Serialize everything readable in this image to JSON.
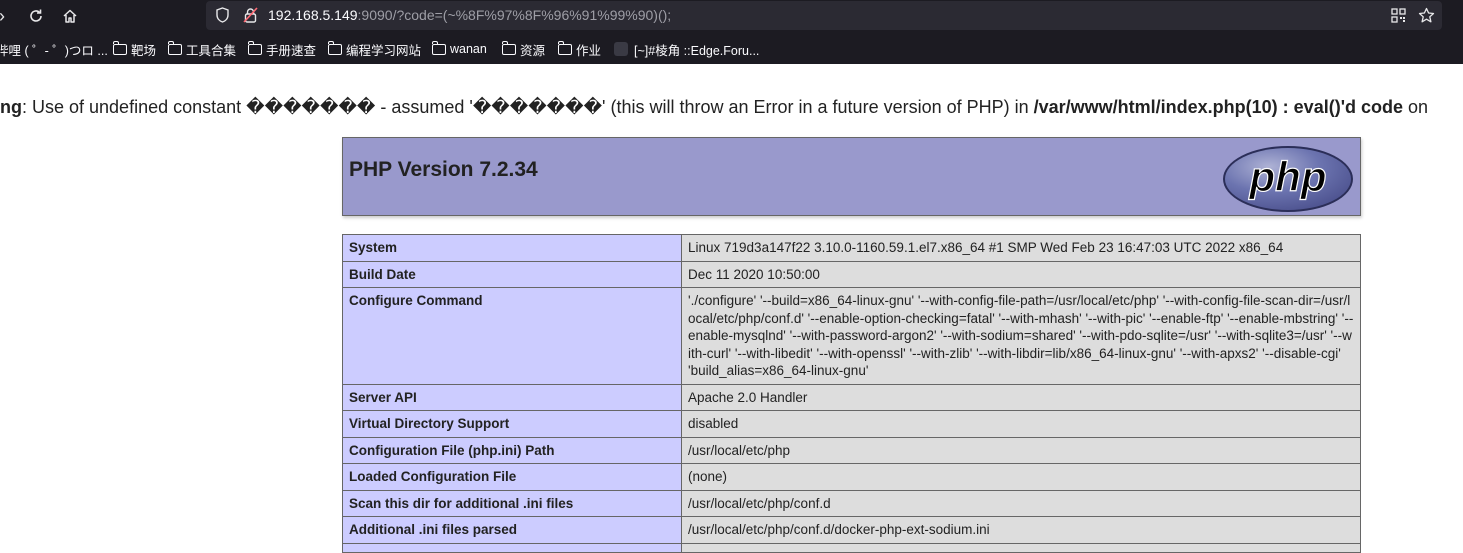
{
  "browser": {
    "url_host": "192.168.5.149",
    "url_rest": ":9090/?code=(~%8F%97%8F%96%91%99%90)();",
    "bookmarks": [
      {
        "label": "哔哩 ( ゜- ゜)つロ ...",
        "type": "link"
      },
      {
        "label": "靶场",
        "type": "folder"
      },
      {
        "label": "工具合集",
        "type": "folder"
      },
      {
        "label": "手册速查",
        "type": "folder"
      },
      {
        "label": "编程学习网站",
        "type": "folder"
      },
      {
        "label": "wanan",
        "type": "folder"
      },
      {
        "label": "资源",
        "type": "folder"
      },
      {
        "label": "作业",
        "type": "folder"
      },
      {
        "label": "[~]#棱角 ::Edge.Foru...",
        "type": "link"
      }
    ]
  },
  "warning": {
    "label": "ng",
    "message_1": ": Use of undefined constant ",
    "garbled_1": "�������",
    "message_2": " - assumed '",
    "garbled_2": "�������",
    "message_3": "' (this will throw an Error in a future version of PHP) in ",
    "file": "/var/www/html/index.php(10) : eval()'d code",
    "message_4": " on"
  },
  "phpinfo": {
    "version_title": "PHP Version 7.2.34",
    "logo_text": "php",
    "rows": [
      {
        "key": "System",
        "value": "Linux 719d3a147f22 3.10.0-1160.59.1.el7.x86_64 #1 SMP Wed Feb 23 16:47:03 UTC 2022 x86_64"
      },
      {
        "key": "Build Date",
        "value": "Dec 11 2020 10:50:00"
      },
      {
        "key": "Configure Command",
        "value": "'./configure' '--build=x86_64-linux-gnu' '--with-config-file-path=/usr/local/etc/php' '--with-config-file-scan-dir=/usr/local/etc/php/conf.d' '--enable-option-checking=fatal' '--with-mhash' '--with-pic' '--enable-ftp' '--enable-mbstring' '--enable-mysqlnd' '--with-password-argon2' '--with-sodium=shared' '--with-pdo-sqlite=/usr' '--with-sqlite3=/usr' '--with-curl' '--with-libedit' '--with-openssl' '--with-zlib' '--with-libdir=lib/x86_64-linux-gnu' '--with-apxs2' '--disable-cgi' 'build_alias=x86_64-linux-gnu'"
      },
      {
        "key": "Server API",
        "value": "Apache 2.0 Handler"
      },
      {
        "key": "Virtual Directory Support",
        "value": "disabled"
      },
      {
        "key": "Configuration File (php.ini) Path",
        "value": "/usr/local/etc/php"
      },
      {
        "key": "Loaded Configuration File",
        "value": "(none)"
      },
      {
        "key": "Scan this dir for additional .ini files",
        "value": "/usr/local/etc/php/conf.d"
      },
      {
        "key": "Additional .ini files parsed",
        "value": "/usr/local/etc/php/conf.d/docker-php-ext-sodium.ini"
      },
      {
        "key": "",
        "value": ""
      }
    ]
  },
  "colors": {
    "toolbar_bg": "#1c1b22",
    "urlbar_bg": "#2b2a33",
    "php_header_bg": "#9999cc",
    "key_cell_bg": "#ccccff",
    "value_cell_bg": "#dddddd"
  }
}
